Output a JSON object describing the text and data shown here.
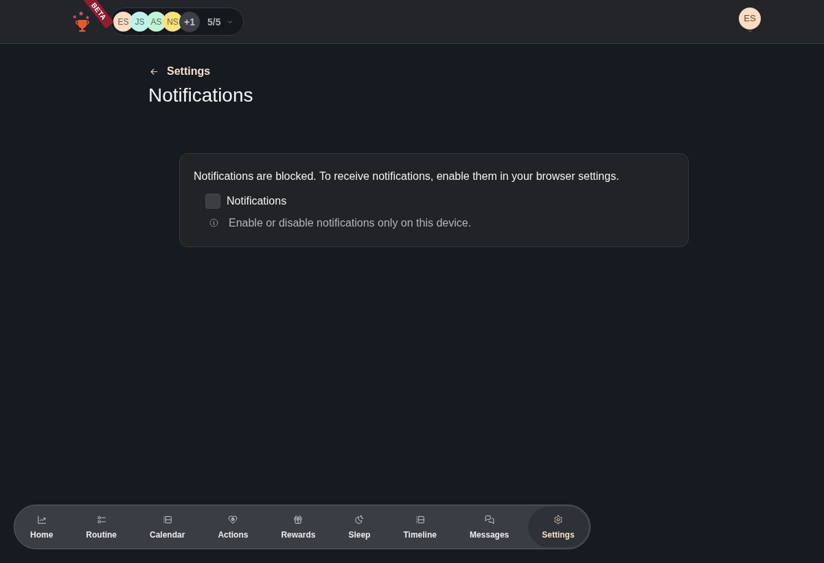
{
  "header": {
    "ribbon": "BETA",
    "members": [
      {
        "initials": "ES",
        "color": "#fddcc4"
      },
      {
        "initials": "JS",
        "color": "#bff3ea"
      },
      {
        "initials": "AS",
        "color": "#c2f3d5"
      },
      {
        "initials": "NS",
        "color": "#fbe27e"
      }
    ],
    "overflow": "+1",
    "member_count": "5/5",
    "account_initials": "ES"
  },
  "page": {
    "back_link": "Settings",
    "title": "Notifications"
  },
  "card": {
    "notice": "Notifications are blocked. To receive notifications, enable them in your browser settings.",
    "checkbox": {
      "label": "Notifications",
      "checked": false
    },
    "hint": "Enable or disable notifications only on this device."
  },
  "bottom_nav": [
    {
      "label": "Home",
      "selected": false
    },
    {
      "label": "Routine",
      "selected": false
    },
    {
      "label": "Calendar",
      "selected": false
    },
    {
      "label": "Actions",
      "selected": false
    },
    {
      "label": "Rewards",
      "selected": false
    },
    {
      "label": "Sleep",
      "selected": false
    },
    {
      "label": "Timeline",
      "selected": false
    },
    {
      "label": "Messages",
      "selected": false
    },
    {
      "label": "Settings",
      "selected": true
    }
  ]
}
